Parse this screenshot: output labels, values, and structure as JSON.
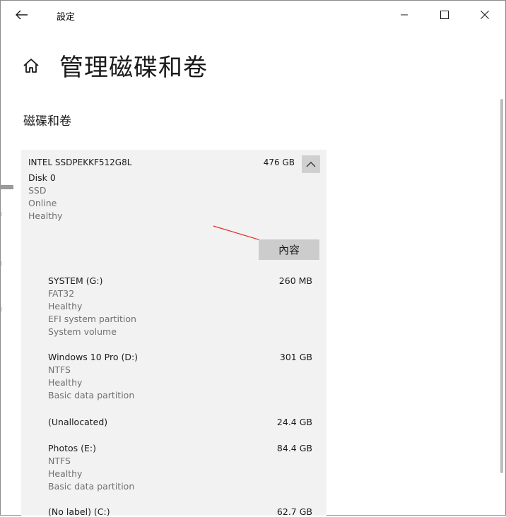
{
  "window": {
    "title": "設定",
    "icons": {
      "back": "back-arrow-icon",
      "minimize": "minimize-icon",
      "maximize": "maximize-icon",
      "close": "close-icon"
    }
  },
  "header": {
    "home_icon": "home-icon",
    "page_title": "管理磁碟和卷"
  },
  "section": {
    "title": "磁碟和卷"
  },
  "disk": {
    "model": "INTEL SSDPEKKF512G8L",
    "size": "476 GB",
    "label": "Disk 0",
    "type": "SSD",
    "status": "Online",
    "health": "Healthy",
    "properties_button": "內容",
    "collapse_icon": "chevron-up-icon"
  },
  "partitions": [
    {
      "name": "SYSTEM (G:)",
      "size": "260 MB",
      "details": [
        "FAT32",
        "Healthy",
        "EFI system partition",
        "System volume"
      ]
    },
    {
      "name": "Windows 10 Pro (D:)",
      "size": "301 GB",
      "details": [
        "NTFS",
        "Healthy",
        "Basic data partition"
      ]
    },
    {
      "name": "(Unallocated)",
      "size": "24.4 GB",
      "details": []
    },
    {
      "name": "Photos (E:)",
      "size": "84.4 GB",
      "details": [
        "NTFS",
        "Healthy",
        "Basic data partition"
      ]
    },
    {
      "name": "(No label) (C:)",
      "size": "62.7 GB",
      "details": []
    }
  ],
  "colors": {
    "panel_bg": "#f2f2f2",
    "button_bg": "#cccccc",
    "annotation_arrow": "#e0302a",
    "secondary_text": "#707070"
  }
}
